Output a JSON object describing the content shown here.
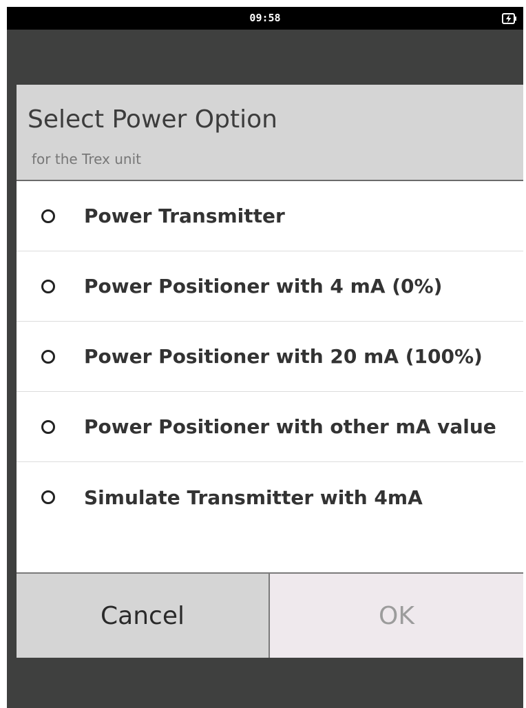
{
  "status_bar": {
    "time": "09:58",
    "battery_icon": "battery-charging-icon"
  },
  "dialog": {
    "title": "Select Power Option",
    "subtitle": "for the Trex unit",
    "options": [
      {
        "label": "Power Transmitter",
        "selected": false
      },
      {
        "label": "Power Positioner with 4 mA (0%)",
        "selected": false
      },
      {
        "label": "Power Positioner with 20 mA (100%)",
        "selected": false
      },
      {
        "label": "Power Positioner with other mA value",
        "selected": false
      },
      {
        "label": "Simulate Transmitter with 4mA",
        "selected": false
      }
    ],
    "buttons": {
      "cancel": "Cancel",
      "ok": "OK"
    }
  },
  "colors": {
    "background": "#3f403f",
    "header": "#d5d5d5",
    "cancel_button": "#d5d5d5",
    "ok_button": "#efe9ed",
    "ok_text_disabled": "#9c9c9c"
  }
}
